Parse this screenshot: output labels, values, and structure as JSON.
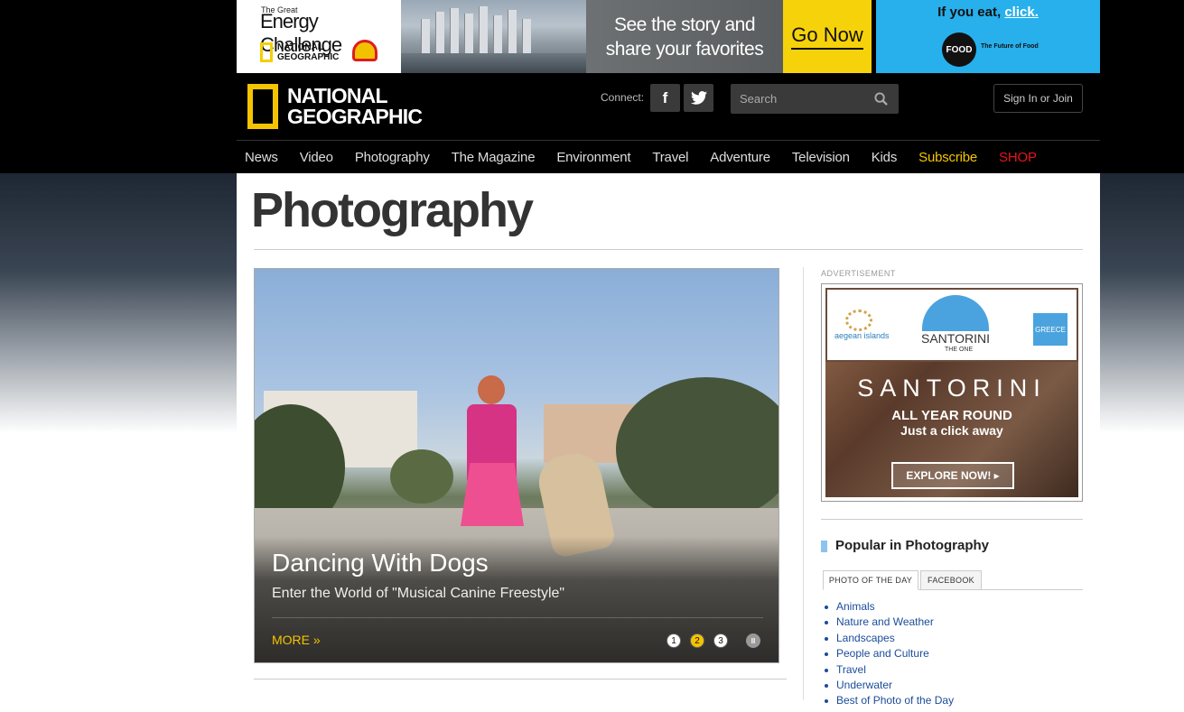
{
  "ads": {
    "energy": {
      "pre_title": "The Great",
      "title": "Energy Challenge",
      "ng_line1": "NATIONAL",
      "ng_line2": "GEOGRAPHIC",
      "story_line1": "See the story and",
      "story_line2": "share your favorites",
      "cta": "Go Now"
    },
    "food": {
      "headline_prefix": "If you eat, ",
      "headline_link": "click.",
      "logo": "FOOD",
      "tagline": "The Future of Food"
    },
    "sidebar_label": "ADVERTISEMENT",
    "santorini": {
      "brand_small": "aegean islands",
      "name_top": "SANTORINI",
      "the_one": "THE ONE",
      "greece": "GREECE",
      "big_title": "SANTORINI",
      "line1": "ALL YEAR ROUND",
      "line2": "Just a click away",
      "cta": "EXPLORE NOW! ▸"
    }
  },
  "header": {
    "logo_line1": "NATIONAL",
    "logo_line2": "GEOGRAPHIC",
    "connect_label": "Connect:",
    "facebook_glyph": "f",
    "search_placeholder": "Search",
    "signin_label": "Sign In or Join"
  },
  "nav": {
    "items": [
      "News",
      "Video",
      "Photography",
      "The Magazine",
      "Environment",
      "Travel",
      "Adventure",
      "Television",
      "Kids",
      "Subscribe",
      "SHOP"
    ]
  },
  "page": {
    "title": "Photography"
  },
  "hero": {
    "title": "Dancing With Dogs",
    "subtitle": "Enter the World of \"Musical Canine Freestyle\"",
    "more_label": "MORE »",
    "slides": [
      "1",
      "2",
      "3"
    ],
    "active_slide": 1,
    "pause_glyph": "II"
  },
  "popular": {
    "title": "Popular in Photography",
    "tabs": [
      "PHOTO OF THE DAY",
      "FACEBOOK"
    ],
    "links": [
      "Animals",
      "Nature and Weather",
      "Landscapes",
      "People and Culture",
      "Travel",
      "Underwater",
      "Best of Photo of the Day"
    ]
  },
  "colors": {
    "accent_yellow": "#f5c400",
    "shop_red": "#e8141e",
    "link_blue": "#1a4c99"
  }
}
